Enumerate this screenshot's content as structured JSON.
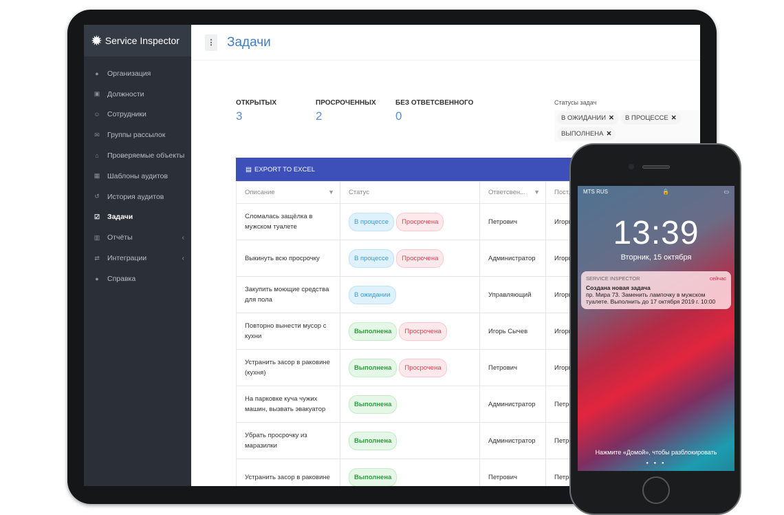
{
  "brand": "Service Inspector",
  "sidebar": {
    "items": [
      {
        "label": "Организация",
        "icon": "globe-icon",
        "glyph": "●"
      },
      {
        "label": "Должности",
        "icon": "briefcase-icon",
        "glyph": "▣"
      },
      {
        "label": "Сотрудники",
        "icon": "users-icon",
        "glyph": "☺"
      },
      {
        "label": "Группы рассылок",
        "icon": "mail-icon",
        "glyph": "✉"
      },
      {
        "label": "Проверяемые объекты",
        "icon": "home-icon",
        "glyph": "⌂"
      },
      {
        "label": "Шаблоны аудитов",
        "icon": "grid-icon",
        "glyph": "▦"
      },
      {
        "label": "История аудитов",
        "icon": "history-icon",
        "glyph": "↺"
      },
      {
        "label": "Задачи",
        "icon": "checkbox-icon",
        "glyph": "☑",
        "active": true
      },
      {
        "label": "Отчёты",
        "icon": "chart-icon",
        "glyph": "▥",
        "chevron": "‹"
      },
      {
        "label": "Интеграции",
        "icon": "exchange-icon",
        "glyph": "⇄",
        "chevron": "‹"
      },
      {
        "label": "Справка",
        "icon": "help-icon",
        "glyph": "●"
      }
    ]
  },
  "header": {
    "title": "Задачи",
    "menu_glyph": "⋮"
  },
  "stats": [
    {
      "label": "ОТКРЫТЫХ",
      "value": "3"
    },
    {
      "label": "ПРОСРОЧЕННЫХ",
      "value": "2"
    },
    {
      "label": "БЕЗ ОТВЕТСВЕННОГО",
      "value": "0"
    }
  ],
  "filters": {
    "label": "Статусы задач",
    "chips": [
      "В ОЖИДАНИИ",
      "В ПРОЦЕССЕ",
      "ВЫПОЛНЕНА"
    ],
    "remove_glyph": "✕"
  },
  "table": {
    "export_label": "EXPORT TO EXCEL",
    "columns": [
      "Описание",
      "Статус",
      "Ответсвен...",
      "Пост..."
    ],
    "rows": [
      {
        "desc": "Сломалась защёлка в мужском туалете",
        "statuses": [
          {
            "t": "В процессе",
            "c": "b-proc"
          },
          {
            "t": "Просрочена",
            "c": "b-over"
          }
        ],
        "resp": "Петрович",
        "post": "Игорь Сычев"
      },
      {
        "desc": "Выкинуть всю просрочку",
        "statuses": [
          {
            "t": "В процессе",
            "c": "b-proc"
          },
          {
            "t": "Просрочена",
            "c": "b-over"
          }
        ],
        "resp": "Администратор",
        "post": "Игорь Сычев"
      },
      {
        "desc": "Закупить моющие средства для пола",
        "statuses": [
          {
            "t": "В ожидании",
            "c": "b-wait"
          }
        ],
        "resp": "Управляющий",
        "post": "Игорь Сычев"
      },
      {
        "desc": "Повторно вынести мусор с кухни",
        "statuses": [
          {
            "t": "Выполнена",
            "c": "b-done"
          },
          {
            "t": "Просрочена",
            "c": "b-over"
          }
        ],
        "resp": "Игорь Сычев",
        "post": "Игорь Сычев"
      },
      {
        "desc": "Устранить засор в раковине (кухня)",
        "statuses": [
          {
            "t": "Выполнена",
            "c": "b-done"
          },
          {
            "t": "Просрочена",
            "c": "b-over"
          }
        ],
        "resp": "Петрович",
        "post": "Игорь Сычев"
      },
      {
        "desc": "На парковке куча чужих машин, вызвать эвакуатор",
        "statuses": [
          {
            "t": "Выполнена",
            "c": "b-done"
          }
        ],
        "resp": "Администратор",
        "post": "Петрович"
      },
      {
        "desc": "Убрать просрочку из маразилки",
        "statuses": [
          {
            "t": "Выполнена",
            "c": "b-done"
          }
        ],
        "resp": "Администратор",
        "post": "Петрович"
      },
      {
        "desc": "Устранить засор в раковине",
        "statuses": [
          {
            "t": "Выполнена",
            "c": "b-done"
          }
        ],
        "resp": "Петрович",
        "post": "Петрович"
      }
    ]
  },
  "phone": {
    "carrier": "MTS RUS",
    "time": "13:39",
    "date": "Вторник, 15 октября",
    "notification": {
      "app": "SERVICE INSPECTOR",
      "when": "сейчас",
      "title": "Создана новая задача",
      "body": "пр. Мира 73. Заменить лампочку в мужском туалете. Выполнить до 17 октября 2019 г. 10:00"
    },
    "unlock_hint": "Нажмите «Домой», чтобы разблокировать"
  }
}
